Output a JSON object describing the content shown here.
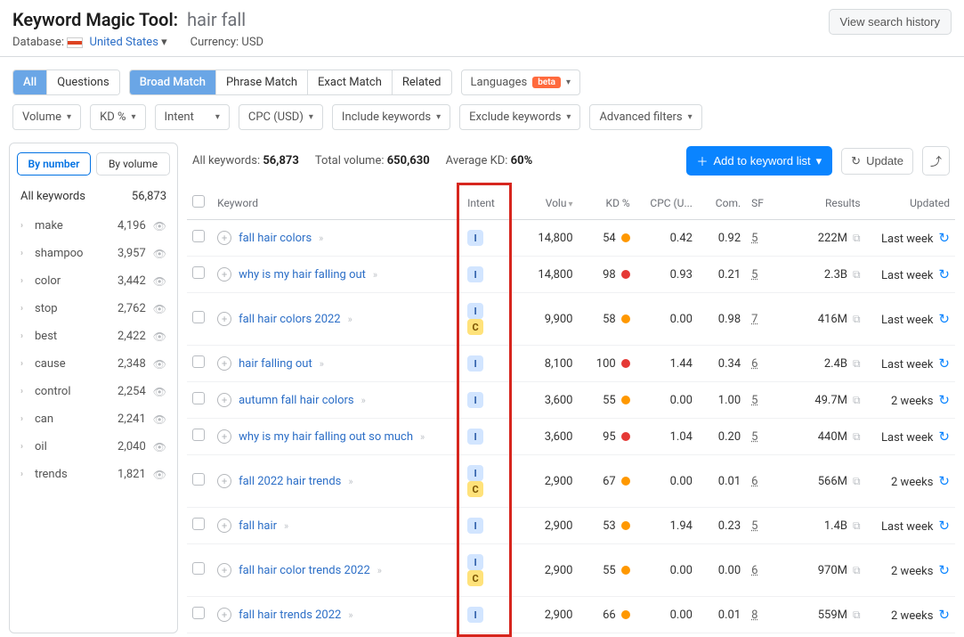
{
  "header": {
    "tool": "Keyword Magic Tool:",
    "query": "hair fall",
    "db_label": "Database:",
    "db_value": "United States",
    "currency_label": "Currency: USD",
    "view_history": "View search history"
  },
  "match_tabs": {
    "all": "All",
    "questions": "Questions",
    "broad": "Broad Match",
    "phrase": "Phrase Match",
    "exact": "Exact Match",
    "related": "Related"
  },
  "lang_pill": {
    "label": "Languages",
    "beta": "beta"
  },
  "filters": {
    "volume": "Volume",
    "kd": "KD %",
    "intent": "Intent",
    "cpc": "CPC (USD)",
    "include": "Include keywords",
    "exclude": "Exclude keywords",
    "advanced": "Advanced filters"
  },
  "sidebar": {
    "tabs": {
      "number": "By number",
      "volume": "By volume"
    },
    "head": {
      "label": "All keywords",
      "count": "56,873"
    },
    "items": [
      {
        "name": "make",
        "count": "4,196"
      },
      {
        "name": "shampoo",
        "count": "3,957"
      },
      {
        "name": "color",
        "count": "3,442"
      },
      {
        "name": "stop",
        "count": "2,762"
      },
      {
        "name": "best",
        "count": "2,422"
      },
      {
        "name": "cause",
        "count": "2,348"
      },
      {
        "name": "control",
        "count": "2,254"
      },
      {
        "name": "can",
        "count": "2,241"
      },
      {
        "name": "oil",
        "count": "2,040"
      },
      {
        "name": "trends",
        "count": "1,821"
      }
    ]
  },
  "summary": {
    "all_label": "All keywords:",
    "all_val": "56,873",
    "vol_label": "Total volume:",
    "vol_val": "650,630",
    "kd_label": "Average KD:",
    "kd_val": "60%",
    "add": "Add to keyword list",
    "update": "Update"
  },
  "columns": {
    "keyword": "Keyword",
    "intent": "Intent",
    "volume": "Volu",
    "kd": "KD %",
    "cpc": "CPC (U...",
    "com": "Com.",
    "sf": "SF",
    "results": "Results",
    "updated": "Updated"
  },
  "rows": [
    {
      "kw": "fall hair colors",
      "intents": [
        "I"
      ],
      "vol": "14,800",
      "kd": "54",
      "kdc": "orange",
      "cpc": "0.42",
      "com": "0.92",
      "sf": "5",
      "res": "222M",
      "upd": "Last week"
    },
    {
      "kw": "why is my hair falling out",
      "intents": [
        "I"
      ],
      "vol": "14,800",
      "kd": "98",
      "kdc": "red",
      "cpc": "0.93",
      "com": "0.21",
      "sf": "5",
      "res": "2.3B",
      "upd": "Last week"
    },
    {
      "kw": "fall hair colors 2022",
      "intents": [
        "I",
        "C"
      ],
      "vol": "9,900",
      "kd": "58",
      "kdc": "orange",
      "cpc": "0.00",
      "com": "0.98",
      "sf": "7",
      "res": "416M",
      "upd": "Last week"
    },
    {
      "kw": "hair falling out",
      "intents": [
        "I"
      ],
      "vol": "8,100",
      "kd": "100",
      "kdc": "red",
      "cpc": "1.44",
      "com": "0.34",
      "sf": "6",
      "res": "2.4B",
      "upd": "Last week"
    },
    {
      "kw": "autumn fall hair colors",
      "intents": [
        "I"
      ],
      "vol": "3,600",
      "kd": "55",
      "kdc": "orange",
      "cpc": "0.00",
      "com": "1.00",
      "sf": "5",
      "res": "49.7M",
      "upd": "2 weeks"
    },
    {
      "kw": "why is my hair falling out so much",
      "intents": [
        "I"
      ],
      "vol": "3,600",
      "kd": "95",
      "kdc": "red",
      "cpc": "1.04",
      "com": "0.20",
      "sf": "5",
      "res": "440M",
      "upd": "Last week"
    },
    {
      "kw": "fall 2022 hair trends",
      "intents": [
        "I",
        "C"
      ],
      "vol": "2,900",
      "kd": "67",
      "kdc": "orange",
      "cpc": "0.00",
      "com": "0.01",
      "sf": "6",
      "res": "566M",
      "upd": "2 weeks"
    },
    {
      "kw": "fall hair",
      "intents": [
        "I"
      ],
      "vol": "2,900",
      "kd": "53",
      "kdc": "orange",
      "cpc": "1.94",
      "com": "0.23",
      "sf": "5",
      "res": "1.4B",
      "upd": "Last week"
    },
    {
      "kw": "fall hair color trends 2022",
      "intents": [
        "I",
        "C"
      ],
      "vol": "2,900",
      "kd": "55",
      "kdc": "orange",
      "cpc": "0.00",
      "com": "0.00",
      "sf": "6",
      "res": "970M",
      "upd": "2 weeks"
    },
    {
      "kw": "fall hair trends 2022",
      "intents": [
        "I"
      ],
      "vol": "2,900",
      "kd": "66",
      "kdc": "orange",
      "cpc": "0.00",
      "com": "0.01",
      "sf": "8",
      "res": "559M",
      "upd": "2 weeks"
    }
  ]
}
